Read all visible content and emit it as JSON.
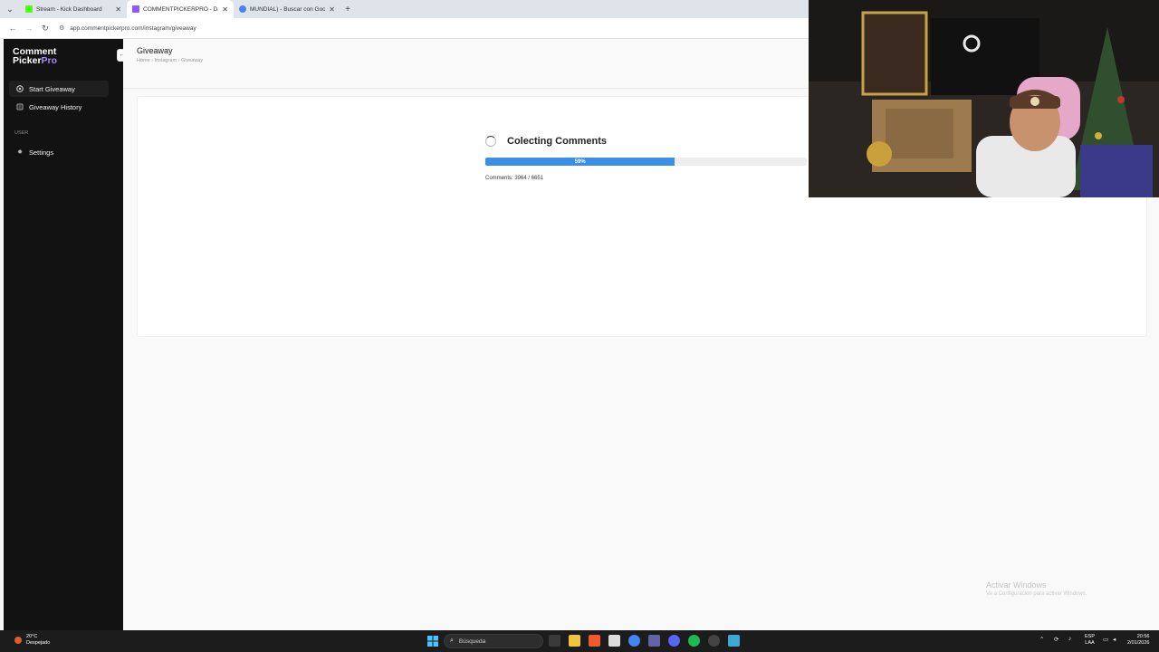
{
  "browser": {
    "tabs": [
      {
        "title": "Stream - Kick Dashboard",
        "favicon_color": "#53fc18",
        "active": false
      },
      {
        "title": "COMMENTPICKERPRO - Dashb",
        "favicon_color": "#8b5cf6",
        "active": true
      },
      {
        "title": "MUNDIAL) - Buscar con Google",
        "favicon_color": "#4285f4",
        "active": false
      }
    ],
    "url": "app.commentpickerpro.com/instagram/giveaway",
    "icons": {
      "back": "back-arrow-icon",
      "forward": "forward-arrow-icon",
      "reload": "reload-icon",
      "site_info": "site-info-icon"
    }
  },
  "sidebar": {
    "logo_line1": "Comment",
    "logo_picker": "Picker",
    "logo_pro": "Pro",
    "items": [
      {
        "label": "Start Giveaway",
        "icon": "target-icon",
        "active": true
      },
      {
        "label": "Giveaway History",
        "icon": "history-icon",
        "active": false
      }
    ],
    "section_label": "USER",
    "settings_label": "Settings",
    "settings_icon": "gear-icon"
  },
  "main": {
    "page_title": "Giveaway",
    "breadcrumb": [
      "Home",
      "Instagram",
      "Giveaway"
    ],
    "status_title": "Colecting Comments",
    "progress_percent": 59,
    "progress_label": "59%",
    "comments_label": "Comments: 3964 / 6651"
  },
  "watermark": {
    "line1": "Activar Windows",
    "line2": "Ve a Configuración para activar Windows."
  },
  "taskbar": {
    "weather_temp": "20°C",
    "weather_desc": "Despejado",
    "search_placeholder": "Búsqueda",
    "lang_line1": "ESP",
    "lang_line2": "LAA",
    "time": "20:56",
    "date": "2/01/2026"
  },
  "colors": {
    "accent": "#3b8fe6",
    "sidebar_bg": "#121212",
    "logo_pro": "#a78bfa"
  }
}
